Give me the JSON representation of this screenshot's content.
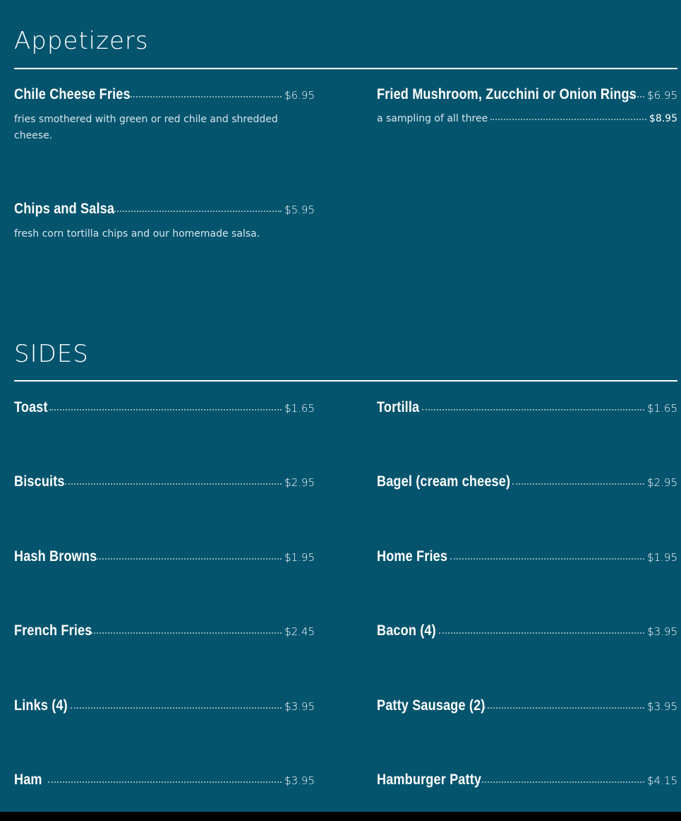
{
  "appetizers": {
    "title": "Appetizers",
    "items": [
      {
        "name": "Chile Cheese Fries",
        "price": "$6.95",
        "description": "fries smothered with green or red chile and shredded cheese."
      },
      {
        "name": "Fried Mushroom, Zucchini or Onion Rings",
        "price": "$6.95",
        "sub_description": "a sampling of all three",
        "sub_price": "$8.95"
      },
      {
        "name": "Chips and Salsa",
        "price": "$5.95",
        "description": "fresh corn tortilla chips and our homemade salsa."
      }
    ]
  },
  "sides": {
    "title": "SIDES",
    "items": [
      {
        "name": "Toast",
        "price": "$1.65"
      },
      {
        "name": "Tortilla",
        "price": "$1.65"
      },
      {
        "name": "Biscuits",
        "price": "$2.95"
      },
      {
        "name": "Bagel (cream cheese)",
        "price": "$2.95"
      },
      {
        "name": "Hash Browns",
        "price": "$1.95"
      },
      {
        "name": "Home Fries",
        "price": "$1.95"
      },
      {
        "name": "French Fries",
        "price": "$2.45"
      },
      {
        "name": "Bacon (4)",
        "price": "$3.95"
      },
      {
        "name": "Links (4)",
        "price": "$3.95"
      },
      {
        "name": "Patty Sausage (2)",
        "price": "$3.95"
      },
      {
        "name": "Ham",
        "price": "$3.95"
      },
      {
        "name": "Hamburger Patty",
        "price": "$4.15"
      }
    ]
  }
}
